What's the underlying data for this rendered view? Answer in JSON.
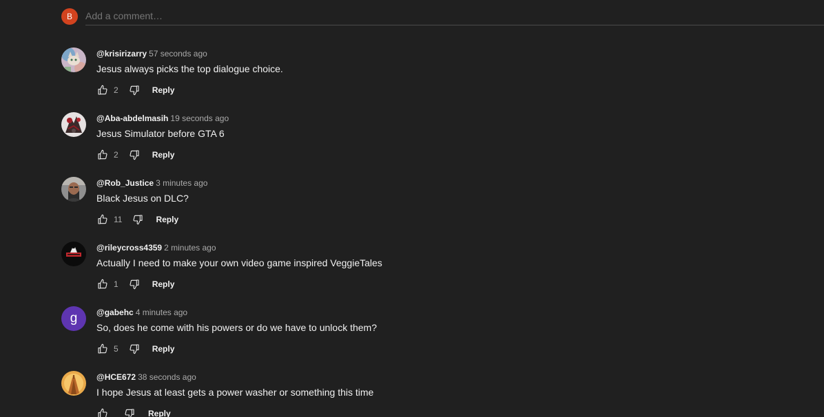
{
  "add_comment": {
    "avatar_letter": "B",
    "placeholder": "Add a comment…"
  },
  "comments": [
    {
      "author": "@krisirizarry",
      "time": "57 seconds ago",
      "text": "Jesus always picks the top dialogue choice.",
      "likes": "2",
      "reply_label": "Reply"
    },
    {
      "author": "@Aba-abdelmasih",
      "time": "19 seconds ago",
      "text": "Jesus Simulator before GTA 6",
      "likes": "2",
      "reply_label": "Reply"
    },
    {
      "author": "@Rob_Justice",
      "time": "3 minutes ago",
      "text": "Black Jesus on DLC?",
      "likes": "11",
      "reply_label": "Reply"
    },
    {
      "author": "@rileycross4359",
      "time": "2 minutes ago",
      "text": "Actually I need to make your own video game inspired VeggieTales",
      "likes": "1",
      "reply_label": "Reply"
    },
    {
      "author": "@gabehc",
      "time": "4 minutes ago",
      "text": "So, does he come with his powers or do we have to unlock them?",
      "likes": "5",
      "reply_label": "Reply",
      "avatar_letter": "g"
    },
    {
      "author": "@HCE672",
      "time": "38 seconds ago",
      "text": "I hope Jesus at least gets a power washer or something this time",
      "likes": "",
      "reply_label": "Reply"
    }
  ]
}
